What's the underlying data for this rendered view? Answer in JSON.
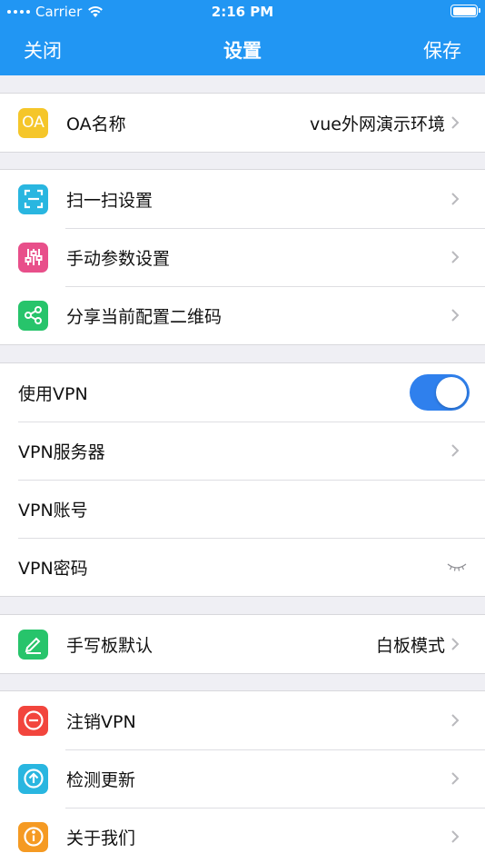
{
  "status_bar": {
    "carrier": "Carrier",
    "time": "2:16 PM"
  },
  "nav": {
    "left": "关闭",
    "title": "设置",
    "right": "保存"
  },
  "oa": {
    "icon_text": "OA",
    "label": "OA名称",
    "value": "vue外网演示环境"
  },
  "setup_group": [
    {
      "label": "扫一扫设置",
      "icon": "scan-icon",
      "color": "#29b6e0"
    },
    {
      "label": "手动参数设置",
      "icon": "sliders-icon",
      "color": "#e84f8a"
    },
    {
      "label": "分享当前配置二维码",
      "icon": "share-icon",
      "color": "#27c46b"
    }
  ],
  "vpn": {
    "use_label": "使用VPN",
    "use_on": true,
    "server_label": "VPN服务器",
    "account_label": "VPN账号",
    "password_label": "VPN密码"
  },
  "handwrite": {
    "label": "手写板默认",
    "value": "白板模式",
    "icon": "pen-icon",
    "color": "#27c46b"
  },
  "bottom_group": [
    {
      "label": "注销VPN",
      "icon": "minus-circle-icon",
      "color": "#f2453d"
    },
    {
      "label": "检测更新",
      "icon": "arrow-up-circle-icon",
      "color": "#29b6e0"
    },
    {
      "label": "关于我们",
      "icon": "info-circle-icon",
      "color": "#f59a23"
    }
  ],
  "colors": {
    "header": "#2196f3",
    "toggle_on": "#2f80ed",
    "oa_icon": "#f5c62a"
  }
}
